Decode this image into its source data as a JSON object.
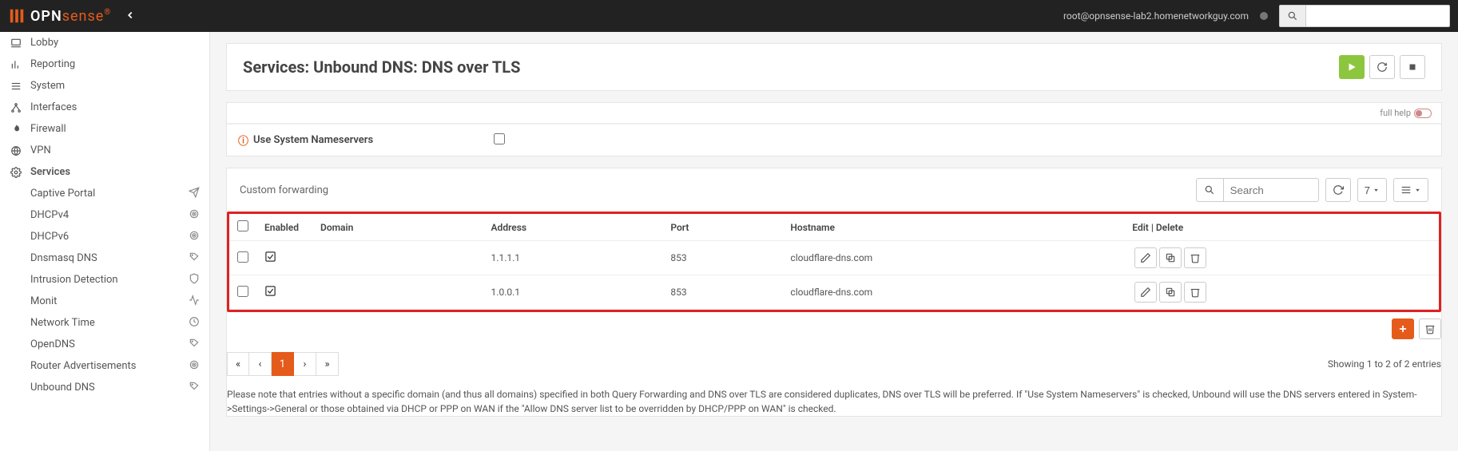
{
  "brand": {
    "part1": "OPN",
    "part2": "sense"
  },
  "header": {
    "userhost": "root@opnsense-lab2.homenetworkguy.com",
    "search_placeholder": ""
  },
  "sidebar": {
    "items": [
      {
        "label": "Lobby",
        "icon": "laptop"
      },
      {
        "label": "Reporting",
        "icon": "chart"
      },
      {
        "label": "System",
        "icon": "list"
      },
      {
        "label": "Interfaces",
        "icon": "network"
      },
      {
        "label": "Firewall",
        "icon": "fire"
      },
      {
        "label": "VPN",
        "icon": "globe"
      },
      {
        "label": "Services",
        "icon": "gear",
        "active": true
      }
    ],
    "services_sub": [
      {
        "label": "Captive Portal",
        "icon": "paper-plane"
      },
      {
        "label": "DHCPv4",
        "icon": "bullseye"
      },
      {
        "label": "DHCPv6",
        "icon": "bullseye"
      },
      {
        "label": "Dnsmasq DNS",
        "icon": "tags"
      },
      {
        "label": "Intrusion Detection",
        "icon": "shield"
      },
      {
        "label": "Monit",
        "icon": "heartbeat"
      },
      {
        "label": "Network Time",
        "icon": "clock"
      },
      {
        "label": "OpenDNS",
        "icon": "tags"
      },
      {
        "label": "Router Advertisements",
        "icon": "bullseye"
      },
      {
        "label": "Unbound DNS",
        "icon": "tags"
      }
    ]
  },
  "page": {
    "title": "Services: Unbound DNS: DNS over TLS",
    "full_help_label": "full help"
  },
  "form": {
    "use_system_nameservers_label": "Use System Nameservers"
  },
  "forwarding": {
    "title": "Custom forwarding",
    "search_placeholder": "Search",
    "page_size": "7",
    "columns": {
      "enabled": "Enabled",
      "domain": "Domain",
      "address": "Address",
      "port": "Port",
      "hostname": "Hostname",
      "editdelete": "Edit | Delete"
    },
    "rows": [
      {
        "enabled": true,
        "domain": "",
        "address": "1.1.1.1",
        "port": "853",
        "hostname": "cloudflare-dns.com"
      },
      {
        "enabled": true,
        "domain": "",
        "address": "1.0.0.1",
        "port": "853",
        "hostname": "cloudflare-dns.com"
      }
    ],
    "showing": "Showing 1 to 2 of 2 entries",
    "pages": [
      "«",
      "‹",
      "1",
      "›",
      "»"
    ],
    "active_page": "1"
  },
  "note": "Please note that entries without a specific domain (and thus all domains) specified in both Query Forwarding and DNS over TLS are considered duplicates, DNS over TLS will be preferred. If \"Use System Nameservers\" is checked, Unbound will use the DNS servers entered in System->Settings->General or those obtained via DHCP or PPP on WAN if the \"Allow DNS server list to be overridden by DHCP/PPP on WAN\" is checked."
}
